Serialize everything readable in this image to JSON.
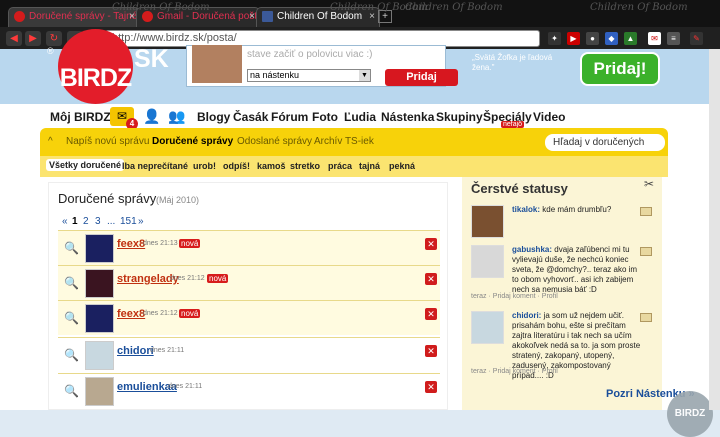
{
  "tabs": [
    {
      "title": "Doručené správy - Tajné ..."
    },
    {
      "title": "Gmail - Doručená pošta - ..."
    },
    {
      "title": "Children Of Bodom"
    }
  ],
  "newtab_label": "+",
  "watermarks": [
    "Children Of Bodom",
    "Children Of Bodom",
    "Children Of Bodom",
    "Children Of Bodom"
  ],
  "browser": {
    "url": "http://www.birdz.sk/posta/",
    "back_icon": "arrow-left-icon",
    "forward_icon": "arrow-right-icon"
  },
  "banner": {
    "logo": "BIRDZ",
    "logo_suffix": "SK",
    "reg": "®",
    "status_placeholder": "stave začiť o polovicu viac :)",
    "status_target": "na nástenku",
    "status_button": "Pridaj",
    "quote": "„Svätá Žofka je ľadová žena.\"",
    "big_button": "Pridaj!"
  },
  "nav": {
    "items": [
      "Môj BIRDZ",
      "Blogy",
      "Časák",
      "Fórum",
      "Foto",
      "Ľudia",
      "Nástenka",
      "Skupiny",
      "Špeciály",
      "Video"
    ],
    "mail_count": "4",
    "new_badge": "nefajô"
  },
  "mail_tabs": [
    "Napíš novú správu",
    "Doručené správy",
    "Odoslané správy",
    "Archív TS-iek"
  ],
  "mail_search_placeholder": "Hľadaj v doručených",
  "filters": [
    "Všetky doručené",
    "Iba neprečítané",
    "urob!",
    "odpíš!",
    "kamoš",
    "stretko",
    "práca",
    "tajná",
    "pekná"
  ],
  "inbox": {
    "title": "Doručené správy",
    "date": "(Máj 2010)",
    "pages": [
      "«",
      "1",
      "2",
      "3",
      "...",
      "151",
      "»"
    ],
    "rows": [
      {
        "name": "feex8",
        "time": "dnes 21:13",
        "badge": "nová"
      },
      {
        "name": "strangelady",
        "time": "dnes 21:12",
        "badge": "nová"
      },
      {
        "name": "feex8",
        "time": "dnes 21:12",
        "badge": "nová"
      },
      {
        "name": "chidori",
        "time": "dnes 21:11",
        "badge": ""
      },
      {
        "name": "emulienkaa",
        "time": "dnes 21:11",
        "badge": ""
      }
    ]
  },
  "statuses": {
    "title": "Čerstvé statusy",
    "items": [
      {
        "user": "tikalok:",
        "text": "kde mám drumbľu?"
      },
      {
        "user": "gabushka:",
        "text": "dvaja zaľúbenci mi tu vylievajú duše, že nechcú koniec sveta, že @domchy?.. teraz ako im to obom vyhovorť.. asi ich zabijem nech sa nemusia báť :D"
      },
      {
        "user": "chidori:",
        "text": "ja som už nejdem učiť. prisahám bohu, ešte si prečítam zajtra literatúru i tak nech sa učím akokoľvek nedá sa to. ja som proste stratený, zakopaný, utopený, zadusený, zakompostovaný prípad.... :D"
      }
    ],
    "meta": [
      "teraz · Pridaj koment · Profil",
      "teraz · Pridaj koment · Profil",
      "teraz · Pridaj koment · Profil"
    ],
    "more": "Pozri Nástenku »"
  },
  "corner_logo": "BIRDZ"
}
